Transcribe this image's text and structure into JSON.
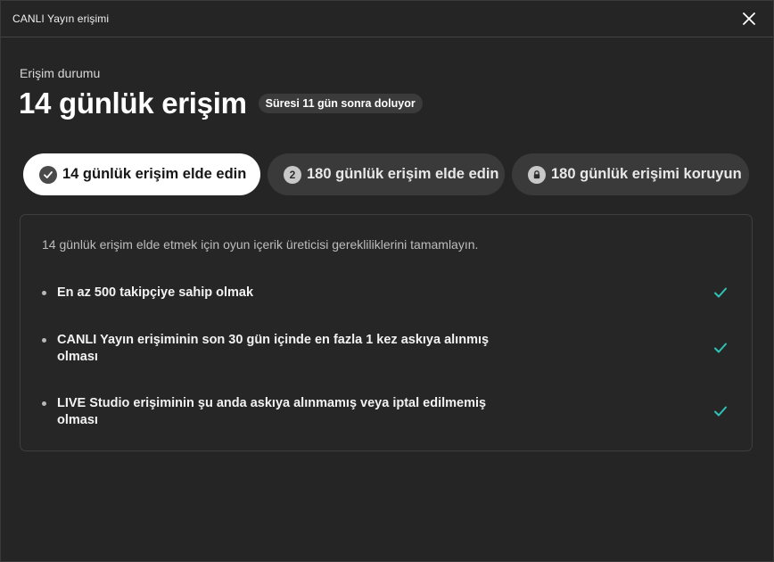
{
  "window": {
    "title": "CANLI Yayın erişimi"
  },
  "status": {
    "label": "Erişim durumu",
    "heading": "14 günlük erişim",
    "badge": "Süresi 11 gün sonra doluyor"
  },
  "tabs": [
    {
      "label": "14 günlük erişim elde edin",
      "icon": "check-circle-icon",
      "state": "selected"
    },
    {
      "label": "180 günlük erişim elde edin",
      "icon": "number-2-icon",
      "icon_text": "2"
    },
    {
      "label": "180 günlük erişimi koruyun",
      "icon": "lock-icon"
    }
  ],
  "panel": {
    "intro": "14 günlük erişim elde etmek için oyun içerik üreticisi gerekliliklerini tamamlayın.",
    "requirements": [
      {
        "text": "En az 500 takipçiye sahip olmak",
        "met": true
      },
      {
        "text": "CANLI Yayın erişiminin son 30 gün içinde en fazla 1 kez askıya alınmış olması",
        "met": true
      },
      {
        "text": "LIVE Studio erişiminin şu anda askıya alınmamış veya iptal edilmemiş olması",
        "met": true
      }
    ]
  },
  "colors": {
    "background": "#252525",
    "check": "#2ec4b6",
    "active_tab": "#ffffff",
    "inactive_tab": "#3a3a3a"
  }
}
